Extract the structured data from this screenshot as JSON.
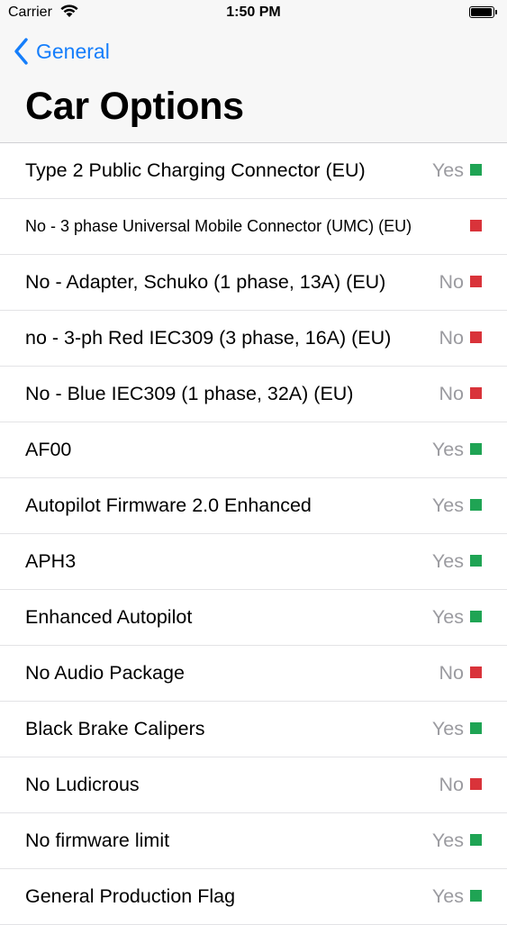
{
  "status_bar": {
    "carrier": "Carrier",
    "time": "1:50 PM",
    "wifi_icon": "wifi-icon",
    "battery_icon": "battery-icon"
  },
  "nav": {
    "back_label": "General",
    "back_icon": "chevron-left-icon",
    "title": "Car Options",
    "accent_color": "#157efb"
  },
  "colors": {
    "yes": "#1fa454",
    "no": "#d9333a"
  },
  "options": [
    {
      "label": "Type 2 Public Charging Connector (EU)",
      "value": "Yes",
      "status": "yes"
    },
    {
      "label": "No - 3 phase Universal Mobile Connector (UMC) (EU)",
      "value": "",
      "status": "no"
    },
    {
      "label": "No - Adapter, Schuko (1 phase, 13A) (EU)",
      "value": "No",
      "status": "no"
    },
    {
      "label": "no - 3-ph Red IEC309 (3 phase, 16A) (EU)",
      "value": "No",
      "status": "no"
    },
    {
      "label": "No - Blue IEC309 (1 phase, 32A) (EU)",
      "value": "No",
      "status": "no"
    },
    {
      "label": "AF00",
      "value": "Yes",
      "status": "yes"
    },
    {
      "label": "Autopilot Firmware 2.0 Enhanced",
      "value": "Yes",
      "status": "yes"
    },
    {
      "label": "APH3",
      "value": "Yes",
      "status": "yes"
    },
    {
      "label": "Enhanced Autopilot",
      "value": "Yes",
      "status": "yes"
    },
    {
      "label": "No Audio Package",
      "value": "No",
      "status": "no"
    },
    {
      "label": "Black Brake Calipers",
      "value": "Yes",
      "status": "yes"
    },
    {
      "label": "No Ludicrous",
      "value": "No",
      "status": "no"
    },
    {
      "label": "No firmware limit",
      "value": "Yes",
      "status": "yes"
    },
    {
      "label": "General Production Flag",
      "value": "Yes",
      "status": "yes"
    }
  ]
}
